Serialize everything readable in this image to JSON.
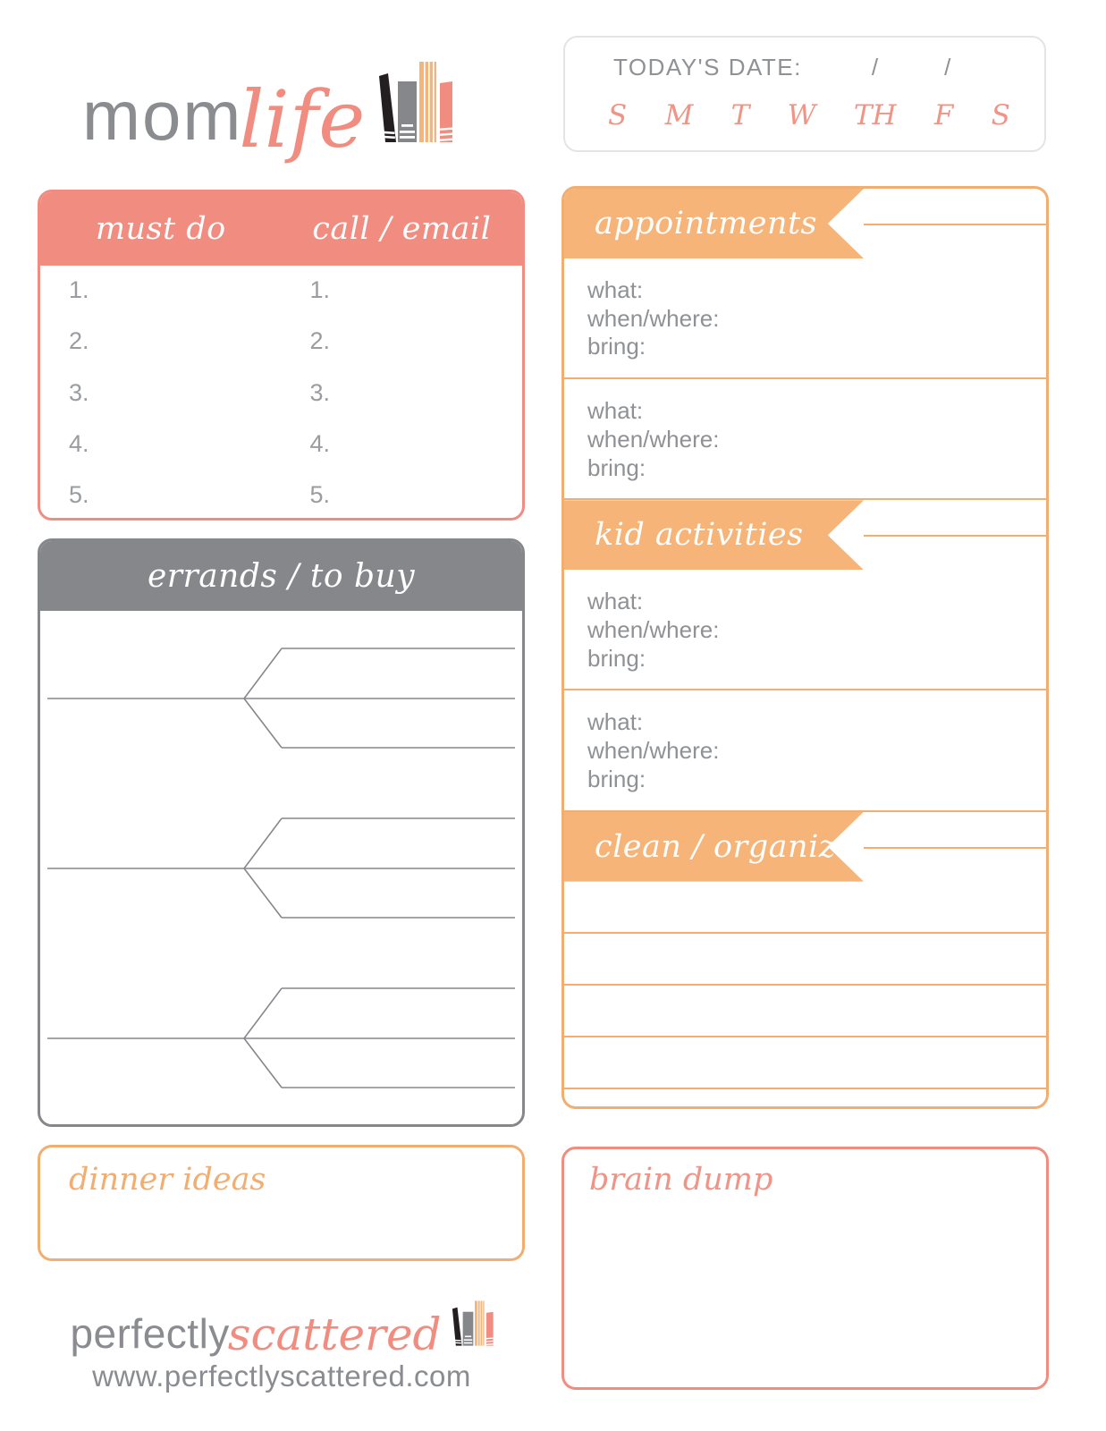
{
  "brand": {
    "logo_primary": "mom",
    "logo_script": "life",
    "books_icon": "books-icon"
  },
  "date_box": {
    "label": "TODAY'S DATE:",
    "slash_1": "/",
    "slash_2": "/",
    "days": [
      "S",
      "M",
      "T",
      "W",
      "TH",
      "F",
      "S"
    ]
  },
  "must_do": {
    "headers": [
      "must do",
      "call / email"
    ],
    "numbers_left": [
      "1.",
      "2.",
      "3.",
      "4.",
      "5."
    ],
    "numbers_right": [
      "1.",
      "2.",
      "3.",
      "4.",
      "5."
    ]
  },
  "errands": {
    "header": "errands / to buy",
    "branch_groups": 3
  },
  "dinner": {
    "header": "dinner ideas"
  },
  "planner": {
    "sections": [
      {
        "banner": "appointments",
        "entries": [
          {
            "what": "what:",
            "when_where": "when/where:",
            "bring": "bring:"
          },
          {
            "what": "what:",
            "when_where": "when/where:",
            "bring": "bring:"
          }
        ]
      },
      {
        "banner": "kid activities",
        "entries": [
          {
            "what": "what:",
            "when_where": "when/where:",
            "bring": "bring:"
          },
          {
            "what": "what:",
            "when_where": "when/where:",
            "bring": "bring:"
          }
        ]
      },
      {
        "banner": "clean / organize",
        "ruled_rows": 5
      }
    ]
  },
  "brain_dump": {
    "header": "brain dump"
  },
  "footer": {
    "logo_primary": "perfectly",
    "logo_script": "scattered",
    "url": "www.perfectlyscattered.com",
    "books_icon": "books-icon"
  },
  "colors": {
    "coral": "#F08D80",
    "coral_text": "#EF9486",
    "orange": "#F6B478",
    "orange_border": "#F2AE71",
    "gray": "#85878B",
    "gray_text": "#8F9194",
    "light_border": "#E3E4E6",
    "white": "#FFFFFF"
  }
}
